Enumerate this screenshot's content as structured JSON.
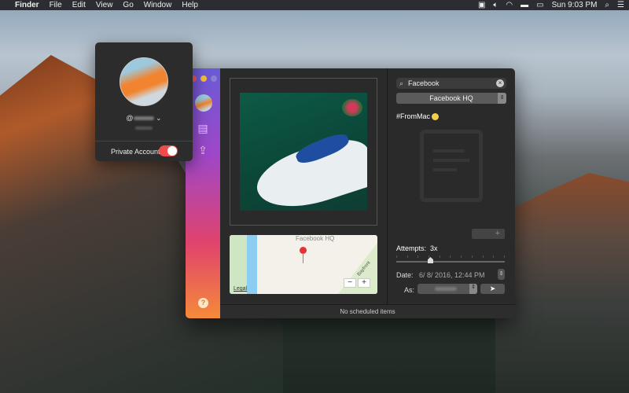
{
  "menubar": {
    "apple": "",
    "app": "Finder",
    "items": [
      "File",
      "Edit",
      "View",
      "Go",
      "Window",
      "Help"
    ],
    "clock": "Sun 9:03 PM"
  },
  "colors": {
    "sidebar_top": "#6a5ad6",
    "sidebar_bottom": "#f58a3a",
    "toggle_on": "#ee4b4b"
  },
  "popover": {
    "username_prefix": "@",
    "chevron": "⌄",
    "private_label": "Private Account",
    "private_on": true
  },
  "sidebar": {
    "help": "?"
  },
  "map": {
    "title": "Facebook HQ",
    "legal": "Legal",
    "zoom_out": "−",
    "zoom_in": "+",
    "road": "Bayfront"
  },
  "panel": {
    "search_value": "Facebook",
    "location": "Facebook HQ",
    "caption": "#FromMac",
    "add": "+",
    "attempts_label": "Attempts:",
    "attempts_value": "3x",
    "attempts": 3,
    "date_label": "Date:",
    "date_value": "6/  8/ 2016, 12:44 PM",
    "as_label": "As:"
  },
  "status": "No scheduled items"
}
